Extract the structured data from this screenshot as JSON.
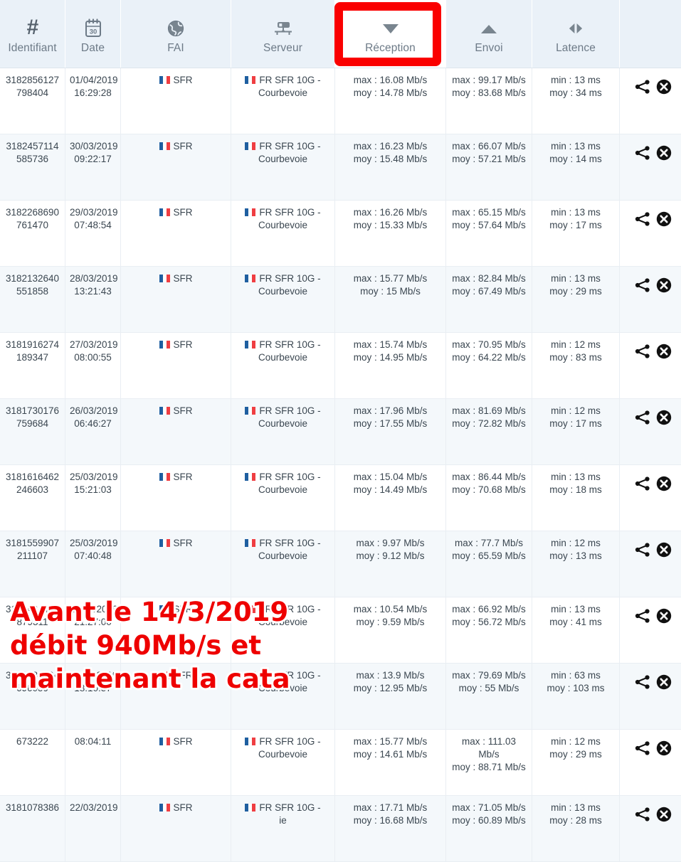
{
  "table": {
    "columns": [
      {
        "key": "id",
        "label": "Identifiant",
        "icon": "hash-icon"
      },
      {
        "key": "date",
        "label": "Date",
        "icon": "calendar-icon",
        "calendar_day": "30"
      },
      {
        "key": "fai",
        "label": "FAI",
        "icon": "globe-icon"
      },
      {
        "key": "server",
        "label": "Serveur",
        "icon": "server-icon"
      },
      {
        "key": "reception",
        "label": "Réception",
        "icon": "download-triangle-icon",
        "highlighted": true
      },
      {
        "key": "envoi",
        "label": "Envoi",
        "icon": "upload-triangle-icon"
      },
      {
        "key": "latence",
        "label": "Latence",
        "icon": "latency-arrows-icon"
      },
      {
        "key": "actions",
        "label": "",
        "icon": ""
      }
    ],
    "row_actions": [
      {
        "name": "share-icon",
        "title": "Partager"
      },
      {
        "name": "delete-icon",
        "title": "Supprimer"
      }
    ],
    "rows": [
      {
        "id_line1": "3182856127",
        "id_line2": "798404",
        "date_line1": "01/04/2019",
        "date_line2": "16:29:28",
        "fai": "SFR",
        "server_line1": "FR SFR 10G -",
        "server_line2": "Courbevoie",
        "reception_line1": "max : 16.08 Mb/s",
        "reception_line2": "moy : 14.78 Mb/s",
        "reception_line3": "",
        "envoi_line1": "max : 99.17 Mb/s",
        "envoi_line2": "moy : 83.68 Mb/s",
        "envoi_line3": "",
        "latence_line1": "min : 13 ms",
        "latence_line2": "moy : 34 ms"
      },
      {
        "id_line1": "3182457114",
        "id_line2": "585736",
        "date_line1": "30/03/2019",
        "date_line2": "09:22:17",
        "fai": "SFR",
        "server_line1": "FR SFR 10G -",
        "server_line2": "Courbevoie",
        "reception_line1": "max : 16.23 Mb/s",
        "reception_line2": "moy : 15.48 Mb/s",
        "reception_line3": "",
        "envoi_line1": "max : 66.07 Mb/s",
        "envoi_line2": "moy : 57.21 Mb/s",
        "envoi_line3": "",
        "latence_line1": "min : 13 ms",
        "latence_line2": "moy : 14 ms"
      },
      {
        "id_line1": "3182268690",
        "id_line2": "761470",
        "date_line1": "29/03/2019",
        "date_line2": "07:48:54",
        "fai": "SFR",
        "server_line1": "FR SFR 10G -",
        "server_line2": "Courbevoie",
        "reception_line1": "max : 16.26 Mb/s",
        "reception_line2": "moy : 15.33 Mb/s",
        "reception_line3": "",
        "envoi_line1": "max : 65.15 Mb/s",
        "envoi_line2": "moy : 57.64 Mb/s",
        "envoi_line3": "",
        "latence_line1": "min : 13 ms",
        "latence_line2": "moy : 17 ms"
      },
      {
        "id_line1": "3182132640",
        "id_line2": "551858",
        "date_line1": "28/03/2019",
        "date_line2": "13:21:43",
        "fai": "SFR",
        "server_line1": "FR SFR 10G -",
        "server_line2": "Courbevoie",
        "reception_line1": "max : 15.77 Mb/s",
        "reception_line2": "moy : 15 Mb/s",
        "reception_line3": "",
        "envoi_line1": "max : 82.84 Mb/s",
        "envoi_line2": "moy : 67.49 Mb/s",
        "envoi_line3": "",
        "latence_line1": "min : 13 ms",
        "latence_line2": "moy : 29 ms"
      },
      {
        "id_line1": "3181916274",
        "id_line2": "189347",
        "date_line1": "27/03/2019",
        "date_line2": "08:00:55",
        "fai": "SFR",
        "server_line1": "FR SFR 10G -",
        "server_line2": "Courbevoie",
        "reception_line1": "max : 15.74 Mb/s",
        "reception_line2": "moy : 14.95 Mb/s",
        "reception_line3": "",
        "envoi_line1": "max : 70.95 Mb/s",
        "envoi_line2": "moy : 64.22 Mb/s",
        "envoi_line3": "",
        "latence_line1": "min : 12 ms",
        "latence_line2": "moy : 83 ms"
      },
      {
        "id_line1": "3181730176",
        "id_line2": "759684",
        "date_line1": "26/03/2019",
        "date_line2": "06:46:27",
        "fai": "SFR",
        "server_line1": "FR SFR 10G -",
        "server_line2": "Courbevoie",
        "reception_line1": "max : 17.96 Mb/s",
        "reception_line2": "moy : 17.55 Mb/s",
        "reception_line3": "",
        "envoi_line1": "max : 81.69 Mb/s",
        "envoi_line2": "moy : 72.82 Mb/s",
        "envoi_line3": "",
        "latence_line1": "min : 12 ms",
        "latence_line2": "moy : 17 ms"
      },
      {
        "id_line1": "3181616462",
        "id_line2": "246603",
        "date_line1": "25/03/2019",
        "date_line2": "15:21:03",
        "fai": "SFR",
        "server_line1": "FR SFR 10G -",
        "server_line2": "Courbevoie",
        "reception_line1": "max : 15.04 Mb/s",
        "reception_line2": "moy : 14.49 Mb/s",
        "reception_line3": "",
        "envoi_line1": "max : 86.44 Mb/s",
        "envoi_line2": "moy : 70.68 Mb/s",
        "envoi_line3": "",
        "latence_line1": "min : 13 ms",
        "latence_line2": "moy : 18 ms"
      },
      {
        "id_line1": "3181559907",
        "id_line2": "211107",
        "date_line1": "25/03/2019",
        "date_line2": "07:40:48",
        "fai": "SFR",
        "server_line1": "FR SFR 10G -",
        "server_line2": "Courbevoie",
        "reception_line1": "max : 9.97 Mb/s",
        "reception_line2": "moy : 9.12 Mb/s",
        "reception_line3": "",
        "envoi_line1": "max : 77.7 Mb/s",
        "envoi_line2": "moy : 65.59 Mb/s",
        "envoi_line3": "",
        "latence_line1": "min : 12 ms",
        "latence_line2": "moy : 13 ms"
      },
      {
        "id_line1": "3181484482",
        "id_line2": "879311",
        "date_line1": "24/03/2019",
        "date_line2": "21:27:00",
        "fai": "SFR",
        "server_line1": "FR SFR 10G -",
        "server_line2": "Courbevoie",
        "reception_line1": "max : 10.54 Mb/s",
        "reception_line2": "moy : 9.59 Mb/s",
        "reception_line3": "",
        "envoi_line1": "max : 66.92 Mb/s",
        "envoi_line2": "moy : 56.72 Mb/s",
        "envoi_line3": "",
        "latence_line1": "min : 13 ms",
        "latence_line2": "moy : 41 ms"
      },
      {
        "id_line1": "3181283404",
        "id_line2": "696059",
        "date_line1": "23/03/2019",
        "date_line2": "18:10:37",
        "fai": "SFR",
        "server_line1": "FR SFR 10G -",
        "server_line2": "Courbevoie",
        "reception_line1": "max : 13.9 Mb/s",
        "reception_line2": "moy : 12.95 Mb/s",
        "reception_line3": "",
        "envoi_line1": "max : 79.69 Mb/s",
        "envoi_line2": "moy : 55 Mb/s",
        "envoi_line3": "",
        "latence_line1": "min : 63 ms",
        "latence_line2": "moy : 103 ms"
      },
      {
        "id_line1": "",
        "id_line2": "673222",
        "date_line1": "",
        "date_line2": "08:04:11",
        "fai": "SFR",
        "server_line1": "FR SFR 10G -",
        "server_line2": "Courbevoie",
        "reception_line1": "max : 15.77 Mb/s",
        "reception_line2": "moy : 14.61 Mb/s",
        "reception_line3": "",
        "envoi_line1": "max : 111.03",
        "envoi_line2": "Mb/s",
        "envoi_line3": "moy : 88.71 Mb/s",
        "latence_line1": "min : 12 ms",
        "latence_line2": "moy : 29 ms"
      },
      {
        "id_line1": "3181078386",
        "id_line2": "",
        "date_line1": "22/03/2019",
        "date_line2": "",
        "fai": "SFR",
        "server_line1": "FR SFR 10G -",
        "server_line2": "ie",
        "reception_line1": "max : 17.71 Mb/s",
        "reception_line2": "moy : 16.68 Mb/s",
        "reception_line3": "",
        "envoi_line1": "max : 71.05 Mb/s",
        "envoi_line2": "moy : 60.89 Mb/s",
        "envoi_line3": "",
        "latence_line1": "min : 13 ms",
        "latence_line2": "moy : 28 ms"
      }
    ]
  },
  "overlay": {
    "lines": [
      "Avant le 14/3/2019",
      "débit 940Mb/s et",
      "maintenant la cata"
    ],
    "color": "#ee0000",
    "outline_color": "#ffffff"
  },
  "colors": {
    "header_bg": "#eaf1f8",
    "row_alt_bg": "#f4f8fb",
    "row_bg": "#ffffff",
    "highlight_box": "#fa0000",
    "text": "#3a4650",
    "header_text": "#6d7a87"
  }
}
